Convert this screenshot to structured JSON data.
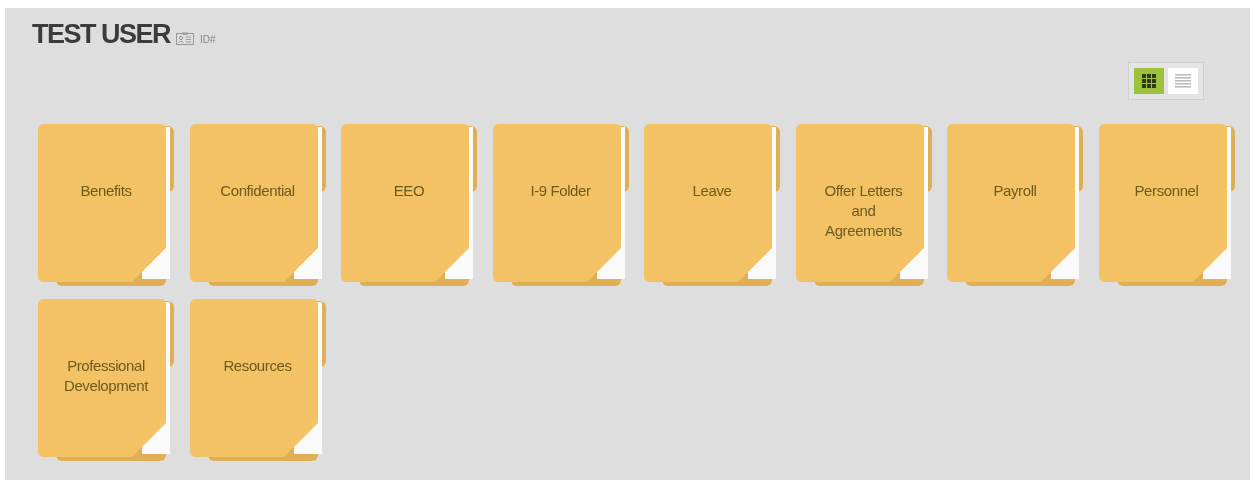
{
  "header": {
    "title": "TEST USER",
    "id_label": "ID#"
  },
  "view_toggle": [
    {
      "kind": "grid",
      "selected": true
    },
    {
      "kind": "list",
      "selected": false
    }
  ],
  "folders": [
    {
      "label": "Benefits"
    },
    {
      "label": "Confidential"
    },
    {
      "label": "EEO"
    },
    {
      "label": "I-9 Folder"
    },
    {
      "label": "Leave"
    },
    {
      "label": "Offer Letters and Agreements"
    },
    {
      "label": "Payroll"
    },
    {
      "label": "Personnel"
    },
    {
      "label": "Professional Development"
    },
    {
      "label": "Resources"
    }
  ]
}
